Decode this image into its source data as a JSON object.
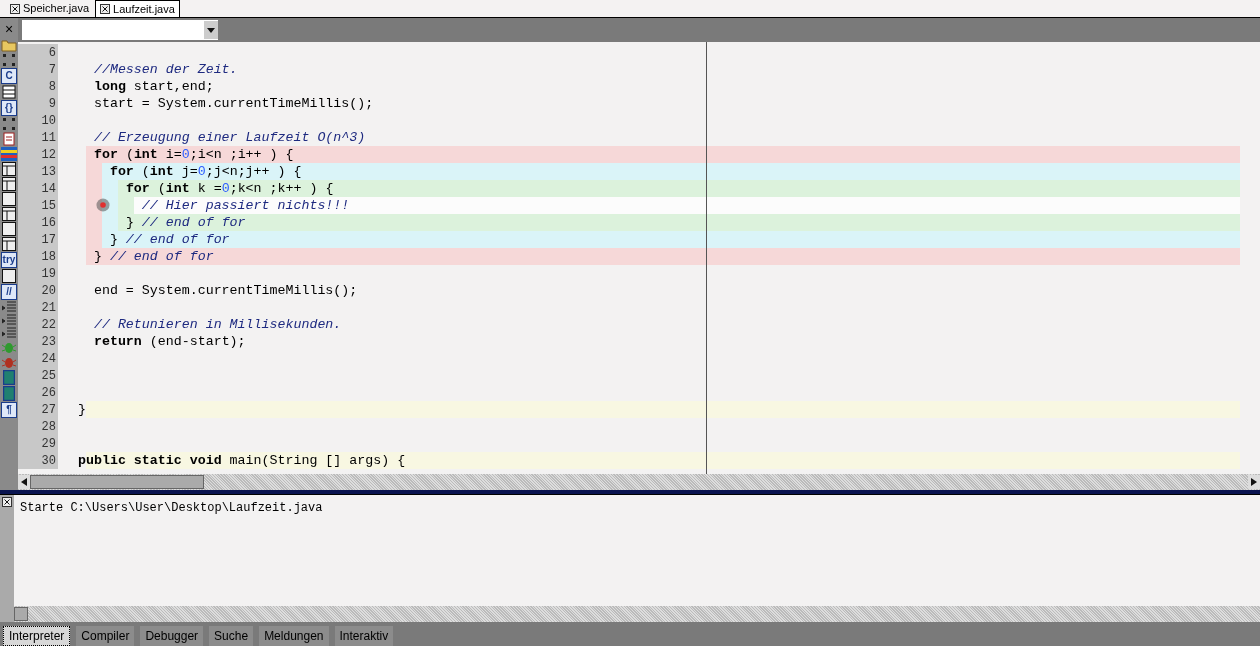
{
  "file_tabs": [
    {
      "label": "Speicher.java",
      "selected": false
    },
    {
      "label": "Laufzeit.java",
      "selected": true
    }
  ],
  "side_tools": [
    {
      "kind": "close",
      "glyph": "×"
    },
    {
      "kind": "folder"
    },
    {
      "kind": "dots"
    },
    {
      "kind": "letter",
      "glyph": "C"
    },
    {
      "kind": "lines"
    },
    {
      "kind": "letter",
      "glyph": "{}"
    },
    {
      "kind": "dots"
    },
    {
      "kind": "doc"
    },
    {
      "kind": "flag"
    },
    {
      "kind": "frame"
    },
    {
      "kind": "frame"
    },
    {
      "kind": "square"
    },
    {
      "kind": "frame"
    },
    {
      "kind": "square"
    },
    {
      "kind": "frame"
    },
    {
      "kind": "letter",
      "glyph": "try"
    },
    {
      "kind": "square"
    },
    {
      "kind": "letter",
      "glyph": "//"
    },
    {
      "kind": "indent"
    },
    {
      "kind": "indent"
    },
    {
      "kind": "indent"
    },
    {
      "kind": "bug",
      "color": "#2f9a2f"
    },
    {
      "kind": "bug",
      "color": "#b03020"
    },
    {
      "kind": "block"
    },
    {
      "kind": "block"
    },
    {
      "kind": "letter",
      "glyph": "¶"
    }
  ],
  "code_lines": [
    {
      "number": "6"
    },
    {
      "number": "7",
      "segments": [
        {
          "text": "  //Messen der Zeit.",
          "kind": "comment"
        }
      ]
    },
    {
      "number": "8",
      "segments": [
        {
          "text": "  long",
          "kind": "keyword"
        },
        {
          "text": " start,end;"
        }
      ]
    },
    {
      "number": "9",
      "segments": [
        {
          "text": "  start = System.currentTimeMillis();"
        }
      ]
    },
    {
      "number": "10"
    },
    {
      "number": "11",
      "segments": [
        {
          "text": "  // Erzeugung einer Laufzeit O(n^3)",
          "kind": "comment"
        }
      ]
    },
    {
      "number": "12",
      "scopes": [
        {
          "color": "#f6d8d8"
        }
      ],
      "segments": [
        {
          "text": "  for",
          "kind": "keyword"
        },
        {
          "text": " ("
        },
        {
          "text": "int",
          "kind": "keyword"
        },
        {
          "text": " i="
        },
        {
          "text": "0",
          "kind": "number"
        },
        {
          "text": ";i<n ;i++ ) {"
        }
      ]
    },
    {
      "number": "13",
      "scopes": [
        {
          "color": "#f6d8d8"
        },
        {
          "color": "#daf4f8"
        }
      ],
      "segments": [
        {
          "text": "    for",
          "kind": "keyword"
        },
        {
          "text": " ("
        },
        {
          "text": "int",
          "kind": "keyword"
        },
        {
          "text": " j="
        },
        {
          "text": "0",
          "kind": "number"
        },
        {
          "text": ";j<n;j++ ) {"
        }
      ]
    },
    {
      "number": "14",
      "scopes": [
        {
          "color": "#f6d8d8"
        },
        {
          "color": "#daf4f8"
        },
        {
          "color": "#dcf2dc"
        }
      ],
      "segments": [
        {
          "text": "      for",
          "kind": "keyword"
        },
        {
          "text": " ("
        },
        {
          "text": "int",
          "kind": "keyword"
        },
        {
          "text": " k ="
        },
        {
          "text": "0",
          "kind": "number"
        },
        {
          "text": ";k<n ;k++ ) {"
        }
      ]
    },
    {
      "number": "15",
      "scopes": [
        {
          "color": "#f6d8d8"
        },
        {
          "color": "#daf4f8"
        },
        {
          "color": "#dcf2dc"
        },
        {
          "color": "#fcfcfc"
        }
      ],
      "segments": [
        {
          "text": "        // Hier passiert nichts!!!",
          "kind": "comment"
        }
      ]
    },
    {
      "number": "16",
      "scopes": [
        {
          "color": "#f6d8d8"
        },
        {
          "color": "#daf4f8"
        },
        {
          "color": "#dcf2dc"
        }
      ],
      "segments": [
        {
          "text": "      }"
        },
        {
          "text": " // end of for",
          "kind": "comment"
        }
      ]
    },
    {
      "number": "17",
      "scopes": [
        {
          "color": "#f6d8d8"
        },
        {
          "color": "#daf4f8"
        }
      ],
      "segments": [
        {
          "text": "    }"
        },
        {
          "text": " // end of for",
          "kind": "comment"
        }
      ]
    },
    {
      "number": "18",
      "scopes": [
        {
          "color": "#f6d8d8"
        }
      ],
      "segments": [
        {
          "text": "  }"
        },
        {
          "text": " // end of for",
          "kind": "comment"
        }
      ]
    },
    {
      "number": "19"
    },
    {
      "number": "20",
      "segments": [
        {
          "text": "  end = System.currentTimeMillis();"
        }
      ]
    },
    {
      "number": "21"
    },
    {
      "number": "22",
      "segments": [
        {
          "text": "  // Retunieren in Millisekunden.",
          "kind": "comment"
        }
      ]
    },
    {
      "number": "23",
      "segments": [
        {
          "text": "  return",
          "kind": "keyword"
        },
        {
          "text": " (end-start);"
        }
      ]
    },
    {
      "number": "24"
    },
    {
      "number": "25"
    },
    {
      "number": "26"
    },
    {
      "number": "27",
      "scopes": [
        {
          "color": "#f8f7e2"
        }
      ],
      "segments": [
        {
          "text": "}"
        }
      ]
    },
    {
      "number": "28"
    },
    {
      "number": "29"
    },
    {
      "number": "30",
      "scopes": [
        {
          "color": "#f8f7e2"
        }
      ],
      "segments": [
        {
          "text": "public static void",
          "kind": "keyword"
        },
        {
          "text": " main(String [] args) {"
        }
      ]
    }
  ],
  "output": {
    "lines": [
      "Starte C:\\Users\\User\\Desktop\\Laufzeit.java"
    ]
  },
  "bottom_tabs": [
    {
      "label": "Interpreter",
      "selected": true
    },
    {
      "label": "Compiler",
      "selected": false
    },
    {
      "label": "Debugger",
      "selected": false
    },
    {
      "label": "Suche",
      "selected": false
    },
    {
      "label": "Meldungen",
      "selected": false
    },
    {
      "label": "Interaktiv",
      "selected": false
    }
  ]
}
